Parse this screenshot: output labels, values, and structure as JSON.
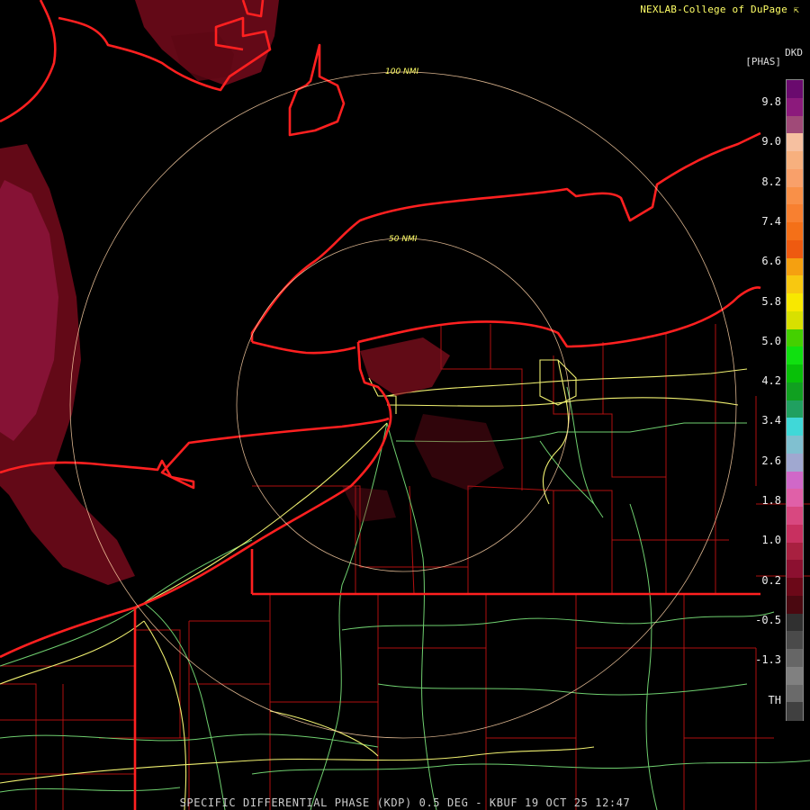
{
  "header": {
    "credit": "NEXLAB-College of DuPage",
    "credit_icon": "link-arrow-icon"
  },
  "legend": {
    "product_code": "DKD",
    "unit": "[PHAS]",
    "ticks": [
      "9.8",
      "9.0",
      "8.2",
      "7.4",
      "6.6",
      "5.8",
      "5.0",
      "4.2",
      "3.4",
      "2.6",
      "1.8",
      "1.0",
      "0.2",
      "-0.5",
      "-1.3",
      "TH"
    ],
    "colors": [
      "#6a0a6e",
      "#8c1a7c",
      "#a04a78",
      "#f6c0a0",
      "#f7b07e",
      "#f9a06a",
      "#f99048",
      "#f88030",
      "#f47018",
      "#ee5a10",
      "#f5a010",
      "#f8c810",
      "#f8e800",
      "#d8e000",
      "#44d000",
      "#10e010",
      "#08c008",
      "#10a020",
      "#20a060",
      "#40d8d8",
      "#80c0d0",
      "#a0a8d0",
      "#d068c8",
      "#e060a8",
      "#d84880",
      "#c83060",
      "#a82040",
      "#8c1030",
      "#6c0818",
      "#4a0810",
      "#303030",
      "#4a4a4a",
      "#666666",
      "#808080",
      "#6a6a6a",
      "#404040"
    ]
  },
  "map": {
    "ring_labels": [
      "50 NMI",
      "100 NMI"
    ],
    "colors": {
      "state_border": "#ff2020",
      "county_border": "#b01010",
      "highways": "#f0f070",
      "roads": "#70d070",
      "range_ring": "#ffd0a0",
      "echo": "#7a0c1e"
    }
  },
  "footer": {
    "caption": "SPECIFIC DIFFERENTIAL PHASE (KDP) 0.5 DEG - KBUF 19 OCT 25 12:47"
  }
}
